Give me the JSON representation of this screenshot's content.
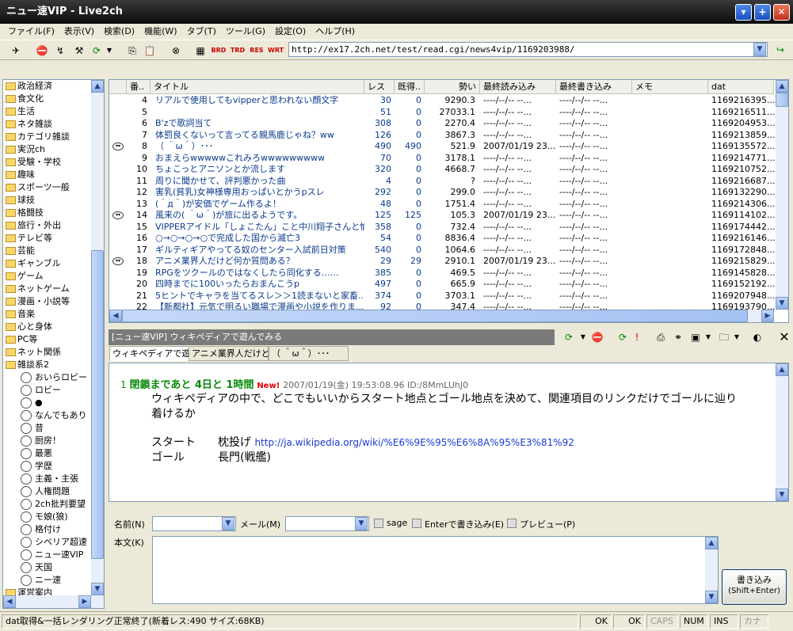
{
  "window": {
    "title": "ニュー速VIP - Live2ch"
  },
  "menu": [
    "ファイル(F)",
    "表示(V)",
    "検索(D)",
    "機能(W)",
    "タブ(T)",
    "ツール(G)",
    "設定(O)",
    "ヘルプ(H)"
  ],
  "address": {
    "url": "http://ex17.2ch.net/test/read.cgi/news4vip/1169203988/"
  },
  "toolbar_labels": {
    "brd": "BRD",
    "trd": "TRD",
    "res": "RES",
    "wrt": "WRT"
  },
  "board_tree": {
    "categories": [
      "政治経済",
      "食文化",
      "生活",
      "ネタ雑談",
      "カテゴリ雑談",
      "実況ch",
      "受験・学校",
      "趣味",
      "スポーツ一般",
      "球技",
      "格闘技",
      "旅行・外出",
      "テレビ等",
      "芸能",
      "ギャンブル",
      "ゲーム",
      "ネットゲーム",
      "漫画・小説等",
      "音楽",
      "心と身体",
      "PC等",
      "ネット関係",
      "雑談系2"
    ],
    "boards": [
      "おいらロビー",
      "ロビー",
      "●",
      "なんでもあり",
      "昔",
      "厨房！",
      "最悪",
      "学歴",
      "主義・主張",
      "人権問題",
      "2ch批判要望",
      "モ娘(狼)",
      "格付け",
      "シベリア超速",
      "ニュー速VIP",
      "天国",
      "ニー速"
    ],
    "last": "運営案内"
  },
  "list": {
    "headers": [
      "番..",
      "タイトル",
      "レス",
      "既得..",
      "勢い",
      "最終読み込み",
      "最終書き込み",
      "メモ",
      "dat"
    ],
    "rows": [
      {
        "icon": false,
        "no": "4",
        "title": "リアルで使用してもvipperと思われない顔文字",
        "res": "30",
        "got": "0",
        "speed": "9290.3",
        "lastread": "----/--/-- --...",
        "lastwrite": "----/--/-- --...",
        "dat": "1169216395..."
      },
      {
        "icon": false,
        "no": "5",
        "title": "",
        "res": "51",
        "got": "0",
        "speed": "27033.1",
        "lastread": "----/--/-- --...",
        "lastwrite": "----/--/-- --...",
        "dat": "1169216511..."
      },
      {
        "icon": false,
        "no": "6",
        "title": "B'zで歌詞当て",
        "res": "308",
        "got": "0",
        "speed": "2270.4",
        "lastread": "----/--/-- --...",
        "lastwrite": "----/--/-- --...",
        "dat": "1169204953..."
      },
      {
        "icon": false,
        "no": "7",
        "title": "体罰良くないって言ってる親馬鹿じゃね？ww",
        "res": "126",
        "got": "0",
        "speed": "3867.3",
        "lastread": "----/--/-- --...",
        "lastwrite": "----/--/-- --...",
        "dat": "1169213859..."
      },
      {
        "icon": true,
        "no": "8",
        "title": "（ ＾ω＾）･･･",
        "res": "490",
        "got": "490",
        "speed": "521.9",
        "lastread": "2007/01/19 23...",
        "lastwrite": "----/--/-- --...",
        "dat": "1169135572..."
      },
      {
        "icon": false,
        "no": "9",
        "title": "おまえらwwwwwこれみろwwwwwwwww",
        "res": "70",
        "got": "0",
        "speed": "3178.1",
        "lastread": "----/--/-- --...",
        "lastwrite": "----/--/-- --...",
        "dat": "1169214771..."
      },
      {
        "icon": false,
        "no": "10",
        "title": "ちょこっとアニソンとか流します",
        "res": "320",
        "got": "0",
        "speed": "4668.7",
        "lastread": "----/--/-- --...",
        "lastwrite": "----/--/-- --...",
        "dat": "1169210752..."
      },
      {
        "icon": false,
        "no": "11",
        "title": "周りに聞かせて、評判悪かった曲",
        "res": "4",
        "got": "0",
        "speed": "?",
        "lastread": "----/--/-- --...",
        "lastwrite": "----/--/-- --...",
        "dat": "1169216687..."
      },
      {
        "icon": false,
        "no": "12",
        "title": "害乳(貧乳)女神様専用おっぱいとかうpスレ",
        "res": "292",
        "got": "0",
        "speed": "299.0",
        "lastread": "----/--/-- --...",
        "lastwrite": "----/--/-- --...",
        "dat": "1169132290..."
      },
      {
        "icon": false,
        "no": "13",
        "title": "(＾д＾)が安価でゲーム作るよ！",
        "res": "48",
        "got": "0",
        "speed": "1751.4",
        "lastread": "----/--/-- --...",
        "lastwrite": "----/--/-- --...",
        "dat": "1169214306..."
      },
      {
        "icon": true,
        "no": "14",
        "title": "風来の( ＾ω＾)が旅に出るようです。",
        "res": "125",
        "got": "125",
        "speed": "105.3",
        "lastread": "2007/01/19 23...",
        "lastwrite": "----/--/-- --...",
        "dat": "1169114102..."
      },
      {
        "icon": false,
        "no": "15",
        "title": "VIPPERアイドル「しょこたん」こと中川翔子さんと愉...",
        "res": "358",
        "got": "0",
        "speed": "732.4",
        "lastread": "----/--/-- --...",
        "lastwrite": "----/--/-- --...",
        "dat": "1169174442..."
      },
      {
        "icon": false,
        "no": "16",
        "title": "○→○→○→○で完成した国から滅亡3",
        "res": "54",
        "got": "0",
        "speed": "8836.4",
        "lastread": "----/--/-- --...",
        "lastwrite": "----/--/-- --...",
        "dat": "1169216146..."
      },
      {
        "icon": false,
        "no": "17",
        "title": "ギルティギアやってる奴のセンター入試前日対策",
        "res": "540",
        "got": "0",
        "speed": "1064.6",
        "lastread": "----/--/-- --...",
        "lastwrite": "----/--/-- --...",
        "dat": "1169172848..."
      },
      {
        "icon": true,
        "no": "18",
        "title": "アニメ業界人だけど何か質問ある？",
        "res": "29",
        "got": "29",
        "speed": "2910.1",
        "lastread": "2007/01/19 23...",
        "lastwrite": "----/--/-- --...",
        "dat": "1169215829..."
      },
      {
        "icon": false,
        "no": "19",
        "title": "RPGをツクールのではなくしたら同化する……",
        "res": "385",
        "got": "0",
        "speed": "469.5",
        "lastread": "----/--/-- --...",
        "lastwrite": "----/--/-- --...",
        "dat": "1169145828..."
      },
      {
        "icon": false,
        "no": "20",
        "title": "四時までに100いったらおまんこうp",
        "res": "497",
        "got": "0",
        "speed": "665.9",
        "lastread": "----/--/-- --...",
        "lastwrite": "----/--/-- --...",
        "dat": "1169152192..."
      },
      {
        "icon": false,
        "no": "21",
        "title": "5ヒントでキャラを当てるスレ＞＞1読まないと家畜...",
        "res": "374",
        "got": "0",
        "speed": "3703.1",
        "lastread": "----/--/-- --...",
        "lastwrite": "----/--/-- --...",
        "dat": "1169207948..."
      },
      {
        "icon": false,
        "no": "22",
        "title": "【新都社】元気で明るい職場で漫画や小説を作りま...",
        "res": "92",
        "got": "0",
        "speed": "347.4",
        "lastread": "----/--/-- --...",
        "lastwrite": "----/--/-- --...",
        "dat": "1169193790..."
      }
    ]
  },
  "thread": {
    "header": "[ニュー速VIP] ウィキペディアで遊んでみる",
    "tabs": [
      "ウィキペディアで遊",
      "アニメ業界人だけど",
      "（ ＾ω＾）･･･"
    ],
    "post": {
      "num": "1",
      "name": "閉鎖まであと 4日と 1時間",
      "new": "New!",
      "date": "2007/01/19(金) 19:53:08.96 ID:/8MmLUhJ0",
      "body1": "ウィキペディアの中で、どこでもいいからスタート地点とゴール地点を決めて、関連項目のリンクだけでゴールに辿り",
      "body2": "着けるか",
      "start_label": "スタート　　枕投げ",
      "start_link": "http://ja.wikipedia.org/wiki/%E6%9E%95%E6%8A%95%E3%81%92",
      "goal": "ゴール　　　長門(戦艦)"
    }
  },
  "form": {
    "name_label": "名前(N)",
    "mail_label": "メール(M)",
    "sage": "sage",
    "enter_label": "Enterで書き込み(E)",
    "preview": "プレビュー(P)",
    "body_label": "本文(K)",
    "submit1": "書き込み",
    "submit2": "(Shift+Enter)"
  },
  "status": {
    "message": "dat取得&一括レンダリング正常終了(新着レス:490 サイズ:68KB)",
    "ok1": "OK",
    "ok2": "OK",
    "caps": "CAPS",
    "num": "NUM",
    "ins": "INS",
    "kana": "カナ"
  }
}
